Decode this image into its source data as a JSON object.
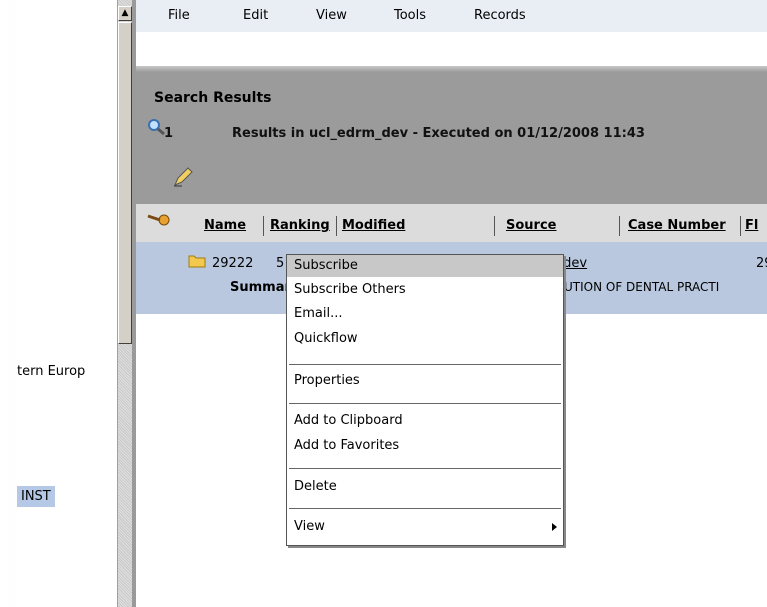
{
  "menu": {
    "file": "File",
    "edit": "Edit",
    "view": "View",
    "tools": "Tools",
    "records": "Records"
  },
  "left": {
    "text1": "tern Europ",
    "text2": "INST"
  },
  "results": {
    "title": "Search Results",
    "count": "1",
    "info": "Results in ucl_edrm_dev - Executed on 01/12/2008 11:43"
  },
  "columns": {
    "name": "Name",
    "ranking": "Ranking",
    "modified": "Modified",
    "source": "Source",
    "case_number": "Case Number",
    "fl": "Fl"
  },
  "row": {
    "name": "29222",
    "rank": "5",
    "source": "m_dev",
    "case": "29",
    "summary": "Summar",
    "desc": "UTION OF DENTAL PRACTI"
  },
  "context_menu": {
    "subscribe": "Subscribe",
    "subscribe_others": "Subscribe Others",
    "email": "Email...",
    "quickflow": "Quickflow",
    "properties": "Properties",
    "add_clipboard": "Add to Clipboard",
    "add_favorites": "Add to Favorites",
    "delete": "Delete",
    "view": "View"
  },
  "colors": {
    "header_gray": "#9b9b9b",
    "row_blue": "#b9c8de",
    "highlight": "#c8c8c8"
  }
}
